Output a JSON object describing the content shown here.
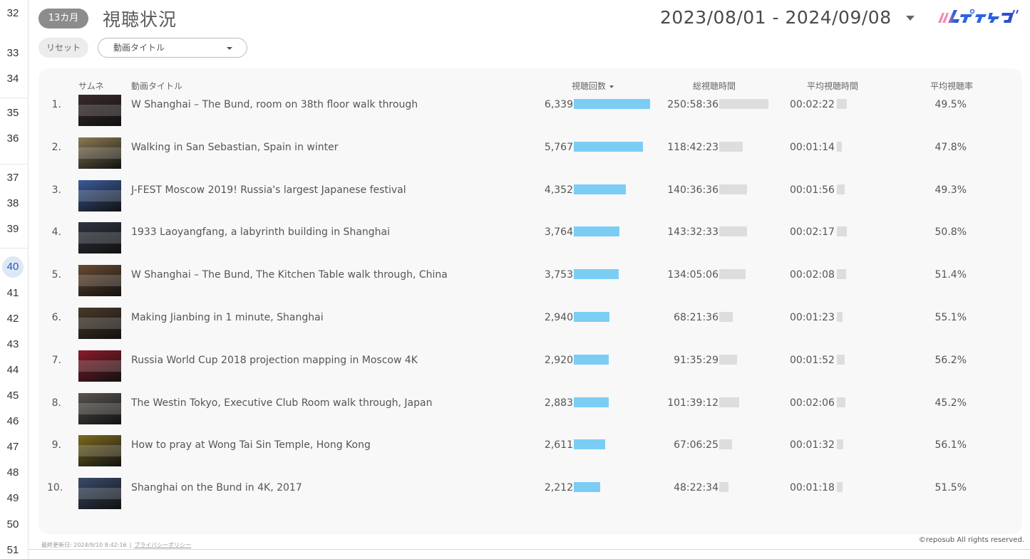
{
  "row_numbers": [
    {
      "n": "32",
      "active": false
    },
    {
      "n": "33",
      "active": false
    },
    {
      "n": "34",
      "active": false
    },
    {
      "n": "35",
      "active": false
    },
    {
      "n": "36",
      "active": false
    },
    {
      "n": "37",
      "active": false
    },
    {
      "n": "38",
      "active": false
    },
    {
      "n": "39",
      "active": false
    },
    {
      "n": "40",
      "active": true
    },
    {
      "n": "41",
      "active": false
    },
    {
      "n": "42",
      "active": false
    },
    {
      "n": "43",
      "active": false
    },
    {
      "n": "44",
      "active": false
    },
    {
      "n": "45",
      "active": false
    },
    {
      "n": "46",
      "active": false
    },
    {
      "n": "47",
      "active": false
    },
    {
      "n": "48",
      "active": false
    },
    {
      "n": "49",
      "active": false
    },
    {
      "n": "50",
      "active": false
    },
    {
      "n": "51",
      "active": false
    }
  ],
  "header": {
    "period_pill": "13カ月",
    "title": "視聴状況",
    "date_range": "2023/08/01 - 2024/09/08",
    "logo_icon": "reposub-logo"
  },
  "controls": {
    "reset_label": "リセット",
    "filter_select_value": "動画タイトル"
  },
  "table": {
    "columns": {
      "thumb": "サムネ",
      "title": "動画タイトル",
      "views": "視聴回数",
      "total_time": "総視聴時間",
      "avg_time": "平均視聴時間",
      "avg_rate": "平均視聴率"
    },
    "bar_colors": {
      "views": "#7ccdf4",
      "time": "#dddddd"
    },
    "rows": [
      {
        "idx": "1.",
        "title": "W Shanghai – The Bund, room on 38th floor walk through",
        "views": "6,339",
        "views_value": 6339,
        "total": "250:58:36",
        "total_hours": 250.98,
        "avg": "00:02:22",
        "avg_seconds": 142,
        "rate": "49.5%",
        "thumb_color": "#3a2a2a"
      },
      {
        "idx": "2.",
        "title": "Walking in San Sebastian, Spain in winter",
        "views": "5,767",
        "views_value": 5767,
        "total": "118:42:23",
        "total_hours": 118.71,
        "avg": "00:01:14",
        "avg_seconds": 74,
        "rate": "47.8%",
        "thumb_color": "#8a7a55"
      },
      {
        "idx": "3.",
        "title": "J-FEST Moscow 2019! Russia's largest Japanese festival",
        "views": "4,352",
        "views_value": 4352,
        "total": "140:36:36",
        "total_hours": 140.61,
        "avg": "00:01:56",
        "avg_seconds": 116,
        "rate": "49.3%",
        "thumb_color": "#3a5a9a"
      },
      {
        "idx": "4.",
        "title": "1933 Laoyangfang, a labyrinth building in Shanghai",
        "views": "3,764",
        "views_value": 3764,
        "total": "143:32:33",
        "total_hours": 143.54,
        "avg": "00:02:17",
        "avg_seconds": 137,
        "rate": "50.8%",
        "thumb_color": "#2e3440"
      },
      {
        "idx": "5.",
        "title": "W Shanghai – The Bund, The Kitchen Table walk through, China",
        "views": "3,753",
        "views_value": 3753,
        "total": "134:05:06",
        "total_hours": 134.09,
        "avg": "00:02:08",
        "avg_seconds": 128,
        "rate": "51.4%",
        "thumb_color": "#6a4a30"
      },
      {
        "idx": "6.",
        "title": "Making Jianbing in 1 minute, Shanghai",
        "views": "2,940",
        "views_value": 2940,
        "total": "68:21:36",
        "total_hours": 68.36,
        "avg": "00:01:23",
        "avg_seconds": 83,
        "rate": "55.1%",
        "thumb_color": "#4a3a2a"
      },
      {
        "idx": "7.",
        "title": "Russia World Cup 2018 projection mapping in Moscow 4K",
        "views": "2,920",
        "views_value": 2920,
        "total": "91:35:29",
        "total_hours": 91.59,
        "avg": "00:01:52",
        "avg_seconds": 112,
        "rate": "56.2%",
        "thumb_color": "#8a1a2a"
      },
      {
        "idx": "8.",
        "title": "The Westin Tokyo, Executive Club Room walk through, Japan",
        "views": "2,883",
        "views_value": 2883,
        "total": "101:39:12",
        "total_hours": 101.65,
        "avg": "00:02:06",
        "avg_seconds": 126,
        "rate": "45.2%",
        "thumb_color": "#5a5550"
      },
      {
        "idx": "9.",
        "title": "How to pray at Wong Tai Sin Temple, Hong Kong",
        "views": "2,611",
        "views_value": 2611,
        "total": "67:06:25",
        "total_hours": 67.11,
        "avg": "00:01:32",
        "avg_seconds": 92,
        "rate": "56.1%",
        "thumb_color": "#7a6a20"
      },
      {
        "idx": "10.",
        "title": "Shanghai on the Bund in 4K, 2017",
        "views": "2,212",
        "views_value": 2212,
        "total": "48:22:34",
        "total_hours": 48.38,
        "avg": "00:01:18",
        "avg_seconds": 78,
        "rate": "51.5%",
        "thumb_color": "#3a4a6a"
      }
    ]
  },
  "footer": {
    "updated": "最終更新日: 2024/9/10 8:42:16",
    "privacy_link": "プライバシーポリシー",
    "copyright": "©reposub All rights reserved."
  }
}
